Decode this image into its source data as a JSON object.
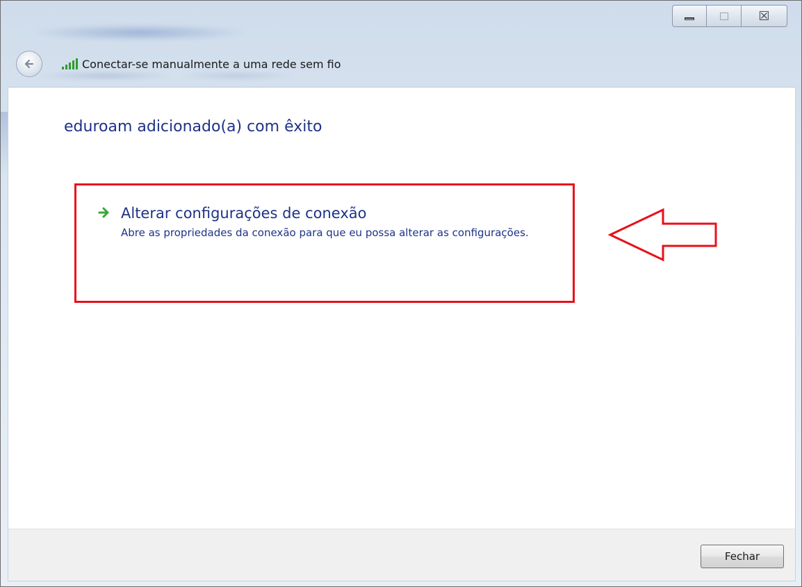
{
  "window": {
    "caption_buttons": {
      "minimize_icon": "minimize-icon",
      "maximize_icon": "maximize-icon",
      "close_glyph": "☒"
    }
  },
  "nav": {
    "back_icon": "back-arrow-icon",
    "signal_icon": "wireless-signal-icon",
    "title": "Conectar-se manualmente a uma rede sem fio"
  },
  "main": {
    "heading": "eduroam adicionado(a) com êxito",
    "task": {
      "icon": "green-arrow-icon",
      "title": "Alterar configurações de conexão",
      "description": "Abre as propriedades da conexão para que eu possa alterar as configurações."
    },
    "annotation": {
      "box_color": "#e8101b",
      "arrow_color": "#e8101b"
    }
  },
  "footer": {
    "close_label": "Fechar"
  },
  "colors": {
    "link_text": "#1e3287",
    "signal_green": "#2e9d2a",
    "arrow_green": "#3aa63a"
  }
}
